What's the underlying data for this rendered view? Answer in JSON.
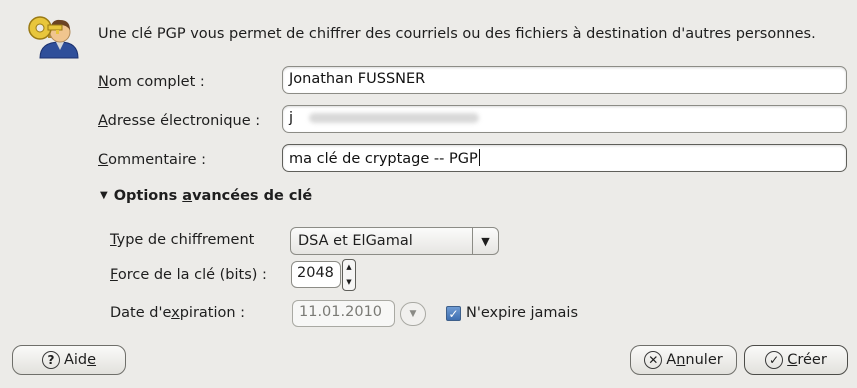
{
  "intro_text": "Une clé PGP vous permet de chiffrer des courriels ou des fichiers à destination d'autres personnes.",
  "fields": {
    "name": {
      "label_pre": "",
      "label_mn": "N",
      "label_post": "om complet :",
      "value": "Jonathan FUSSNER"
    },
    "email": {
      "label_pre": "",
      "label_mn": "A",
      "label_post": "dresse électronique :",
      "value": "j"
    },
    "comment": {
      "label_pre": "",
      "label_mn": "C",
      "label_post": "ommentaire :",
      "value": "ma clé de cryptage -- PGP"
    }
  },
  "advanced": {
    "header_pre": "Options ",
    "header_mn": "a",
    "header_post": "vancées de clé",
    "type_label_pre": "",
    "type_label_mn": "T",
    "type_label_post": "ype de chiffrement",
    "type_value": "DSA et ElGamal",
    "strength_label_pre": "",
    "strength_label_mn": "F",
    "strength_label_post": "orce de la clé (bits) :",
    "strength_value": "2048",
    "expiry_label_pre": "Date d'e",
    "expiry_label_mn": "x",
    "expiry_label_post": "piration :",
    "expiry_value": "11.01.2010",
    "never_expires_label": "N'expire jamais",
    "never_expires_checked": true
  },
  "buttons": {
    "help_pre": "Aid",
    "help_mn": "e",
    "help_post": "",
    "cancel_pre": "A",
    "cancel_mn": "n",
    "cancel_post": "nuler",
    "create_pre": "",
    "create_mn": "C",
    "create_post": "réer"
  },
  "icons": {
    "header": "key-person-icon",
    "help": "question-icon",
    "cancel": "x-icon",
    "create": "check-icon"
  },
  "colors": {
    "background": "#ecebe8",
    "checkbox_fill": "#4a7bbf"
  }
}
